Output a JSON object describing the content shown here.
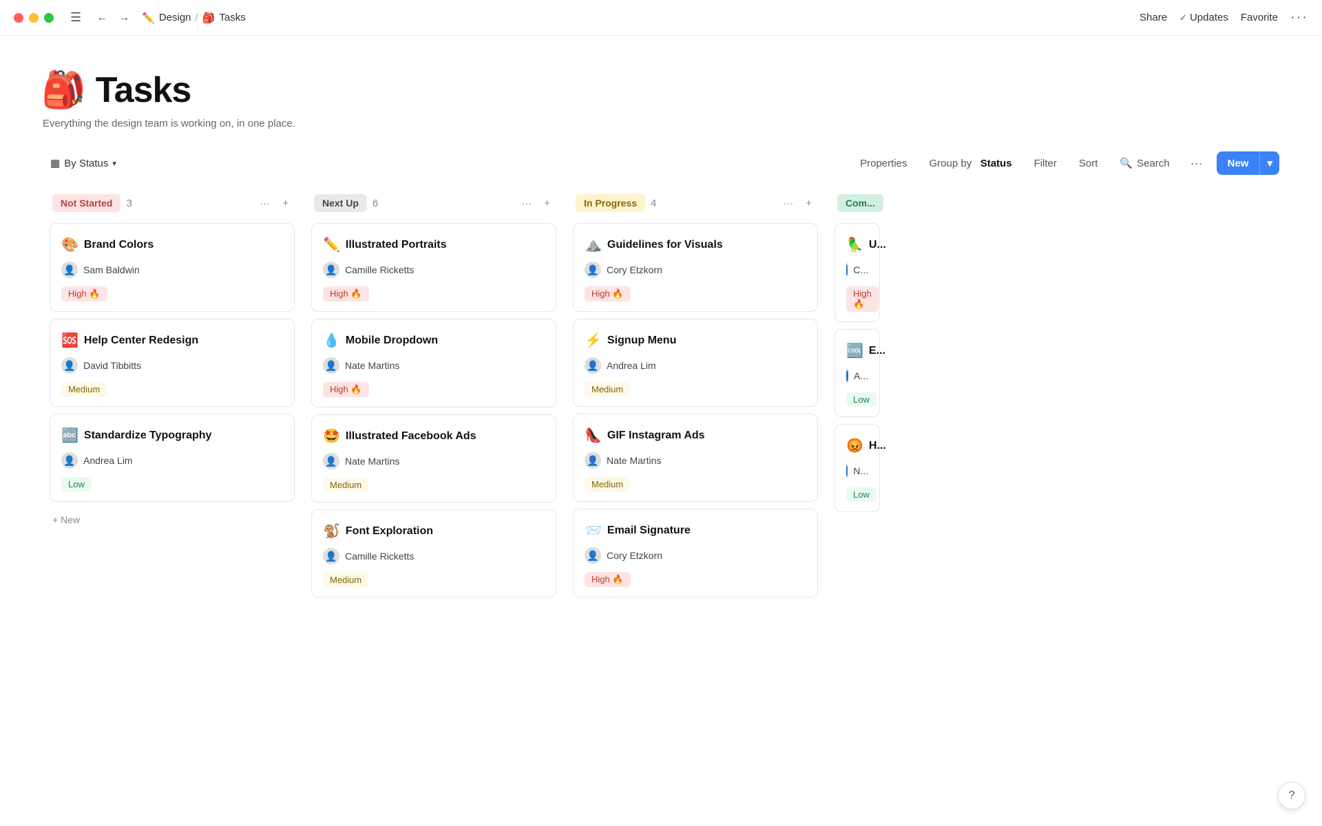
{
  "titlebar": {
    "breadcrumb_parent": "Design",
    "breadcrumb_current": "Tasks",
    "share_label": "Share",
    "updates_label": "Updates",
    "favorite_label": "Favorite"
  },
  "page": {
    "icon": "🎒",
    "title": "Tasks",
    "subtitle": "Everything the design team is working on, in one place."
  },
  "toolbar": {
    "group_by_label": "By Status",
    "properties_label": "Properties",
    "group_by_prefix": "Group by",
    "group_by_value": "Status",
    "filter_label": "Filter",
    "sort_label": "Sort",
    "search_label": "Search",
    "new_label": "New"
  },
  "columns": [
    {
      "id": "not-started",
      "status": "Not Started",
      "badge_class": "badge-not-started",
      "count": 3,
      "cards": [
        {
          "icon": "🎨",
          "title": "Brand Colors",
          "assignee_emoji": "👤",
          "assignee": "Sam Baldwin",
          "priority": "High",
          "priority_class": "priority-high",
          "priority_emoji": "🔥"
        },
        {
          "icon": "🆘",
          "title": "Help Center Redesign",
          "assignee_emoji": "👤",
          "assignee": "David Tibbitts",
          "priority": "Medium",
          "priority_class": "priority-medium",
          "priority_emoji": ""
        },
        {
          "icon": "🔤",
          "title": "Standardize Typography",
          "assignee_emoji": "👤",
          "assignee": "Andrea Lim",
          "priority": "Low",
          "priority_class": "priority-low",
          "priority_emoji": ""
        }
      ]
    },
    {
      "id": "next-up",
      "status": "Next Up",
      "badge_class": "badge-next-up",
      "count": 6,
      "cards": [
        {
          "icon": "✏️",
          "title": "Illustrated Portraits",
          "assignee_emoji": "👤",
          "assignee": "Camille Ricketts",
          "priority": "High",
          "priority_class": "priority-high",
          "priority_emoji": "🔥"
        },
        {
          "icon": "💧",
          "title": "Mobile Dropdown",
          "assignee_emoji": "👤",
          "assignee": "Nate Martins",
          "priority": "High",
          "priority_class": "priority-high",
          "priority_emoji": "🔥"
        },
        {
          "icon": "🤩",
          "title": "Illustrated Facebook Ads",
          "assignee_emoji": "👤",
          "assignee": "Nate Martins",
          "priority": "Medium",
          "priority_class": "priority-medium",
          "priority_emoji": ""
        },
        {
          "icon": "🐒",
          "title": "Font Exploration",
          "assignee_emoji": "👤",
          "assignee": "Camille Ricketts",
          "priority": "Medium",
          "priority_class": "priority-medium",
          "priority_emoji": ""
        }
      ]
    },
    {
      "id": "in-progress",
      "status": "In Progress",
      "badge_class": "badge-in-progress",
      "count": 4,
      "cards": [
        {
          "icon": "⛰️",
          "title": "Guidelines for Visuals",
          "assignee_emoji": "👤",
          "assignee": "Cory Etzkorn",
          "priority": "High",
          "priority_class": "priority-high",
          "priority_emoji": "🔥"
        },
        {
          "icon": "⚡",
          "title": "Signup Menu",
          "assignee_emoji": "👤",
          "assignee": "Andrea Lim",
          "priority": "Medium",
          "priority_class": "priority-medium",
          "priority_emoji": ""
        },
        {
          "icon": "👠",
          "title": "GIF Instagram Ads",
          "assignee_emoji": "👤",
          "assignee": "Nate Martins",
          "priority": "Medium",
          "priority_class": "priority-medium",
          "priority_emoji": ""
        },
        {
          "icon": "📨",
          "title": "Email Signature",
          "assignee_emoji": "👤",
          "assignee": "Cory Etzkorn",
          "priority": "High",
          "priority_class": "priority-high",
          "priority_emoji": "🔥"
        }
      ]
    },
    {
      "id": "complete",
      "status": "Com...",
      "badge_class": "badge-complete",
      "count": "",
      "cards": [
        {
          "icon": "🦜",
          "title": "U...",
          "assignee_emoji": "👤",
          "assignee": "C...",
          "priority": "High",
          "priority_class": "priority-high",
          "priority_emoji": "🔥"
        },
        {
          "icon": "🆒",
          "title": "E...",
          "assignee_emoji": "👤",
          "assignee": "A...",
          "priority": "Low",
          "priority_class": "priority-low",
          "priority_emoji": ""
        },
        {
          "icon": "😡",
          "title": "H...",
          "assignee_emoji": "👤",
          "assignee": "N...",
          "priority": "Low",
          "priority_class": "priority-low",
          "priority_emoji": ""
        }
      ]
    }
  ],
  "add_new_label": "+ New",
  "help_label": "?"
}
